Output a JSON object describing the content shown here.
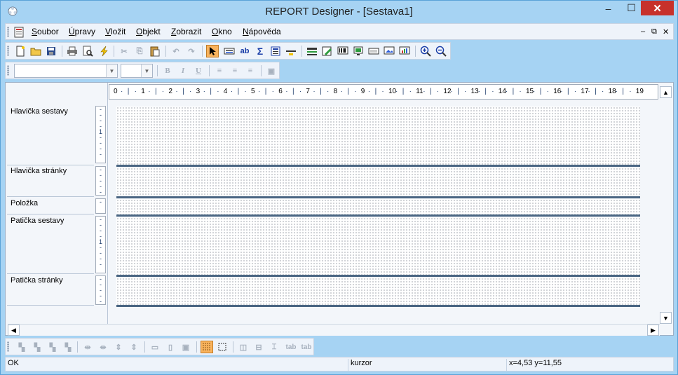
{
  "window": {
    "title": "REPORT Designer - [Sestava1]",
    "controls": {
      "minimize": "–",
      "maximize": "☐",
      "close": "✕"
    }
  },
  "menubar": {
    "items": [
      {
        "label": "Soubor"
      },
      {
        "label": "Úpravy"
      },
      {
        "label": "Vložit"
      },
      {
        "label": "Objekt"
      },
      {
        "label": "Zobrazit"
      },
      {
        "label": "Okno"
      },
      {
        "label": "Nápověda"
      }
    ],
    "mdi_controls": [
      "–",
      "⧉",
      "✕"
    ]
  },
  "toolbar_format": {
    "font_value": "",
    "size_value": "",
    "bold": "B",
    "italic": "I",
    "underline": "U"
  },
  "ruler": {
    "labels": [
      "0",
      "1",
      "2",
      "3",
      "4",
      "5",
      "6",
      "7",
      "8",
      "9",
      "10",
      "11",
      "12",
      "13",
      "14",
      "15",
      "16",
      "17",
      "18",
      "19"
    ]
  },
  "sections": [
    {
      "label": "Hlavička sestavy"
    },
    {
      "label": "Hlavička stránky"
    },
    {
      "label": "Položka"
    },
    {
      "label": "Patička sestavy"
    },
    {
      "label": "Patička stránky"
    }
  ],
  "vruler_marks": {
    "one": "1"
  },
  "toolbar_bottom": {
    "tab1": "tab",
    "tab2": "tab"
  },
  "statusbar": {
    "status": "OK",
    "mode": "kurzor",
    "coords": "x=4,53  y=11,55"
  }
}
